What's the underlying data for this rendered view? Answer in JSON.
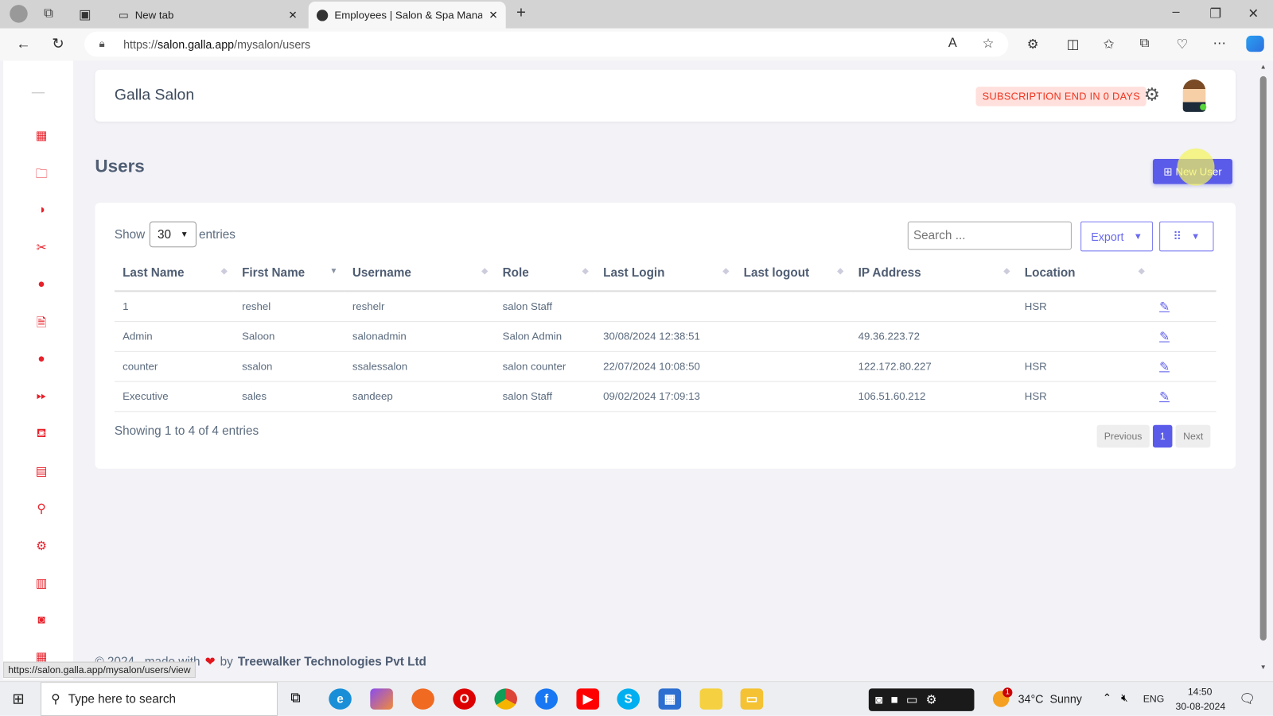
{
  "browser": {
    "tabs": [
      {
        "label": "New tab"
      },
      {
        "label": "Employees | Salon & Spa Manage"
      }
    ],
    "url_prefix": "https://",
    "url_host": "salon.galla.app",
    "url_path": "/mysalon/users",
    "status_url": "https://salon.galla.app/mysalon/users/view"
  },
  "header": {
    "title": "Galla Salon",
    "subscription": "SUBSCRIPTION END IN 0 DAYS"
  },
  "page": {
    "title": "Users",
    "new_user": "New User"
  },
  "table_controls": {
    "show": "Show",
    "entries_value": "30",
    "entries": "entries",
    "search_placeholder": "Search ...",
    "export": "Export"
  },
  "columns": [
    "Last Name",
    "First Name",
    "Username",
    "Role",
    "Last Login",
    "Last logout",
    "IP Address",
    "Location"
  ],
  "rows": [
    [
      "1",
      "reshel",
      "reshelr",
      "salon Staff",
      "",
      "",
      "",
      "HSR"
    ],
    [
      "Admin",
      "Saloon",
      "salonadmin",
      "Salon Admin",
      "30/08/2024 12:38:51",
      "",
      "49.36.223.72",
      ""
    ],
    [
      "counter",
      "ssalon",
      "ssalessalon",
      "salon counter",
      "22/07/2024 10:08:50",
      "",
      "122.172.80.227",
      "HSR"
    ],
    [
      "Executive",
      "sales",
      "sandeep",
      "salon Staff",
      "09/02/2024 17:09:13",
      "",
      "106.51.60.212",
      "HSR"
    ]
  ],
  "footer_info": "Showing 1 to 4 of 4 entries",
  "pagination": {
    "previous": "Previous",
    "current": "1",
    "next": "Next"
  },
  "footer": {
    "copyright": "© 2024 , made with",
    "by": "by",
    "company": "Treewalker Technologies Pvt Ltd"
  },
  "colors": {
    "accent": "#5b5bea",
    "sidebar_icon": "#e8202a",
    "badge_text": "#f0341f"
  },
  "taskbar": {
    "search": "Type here to search",
    "weather": "34°C  Sunny",
    "lang": "ENG",
    "time": "14:50",
    "date": "30-08-2024",
    "notification_count": "1"
  }
}
